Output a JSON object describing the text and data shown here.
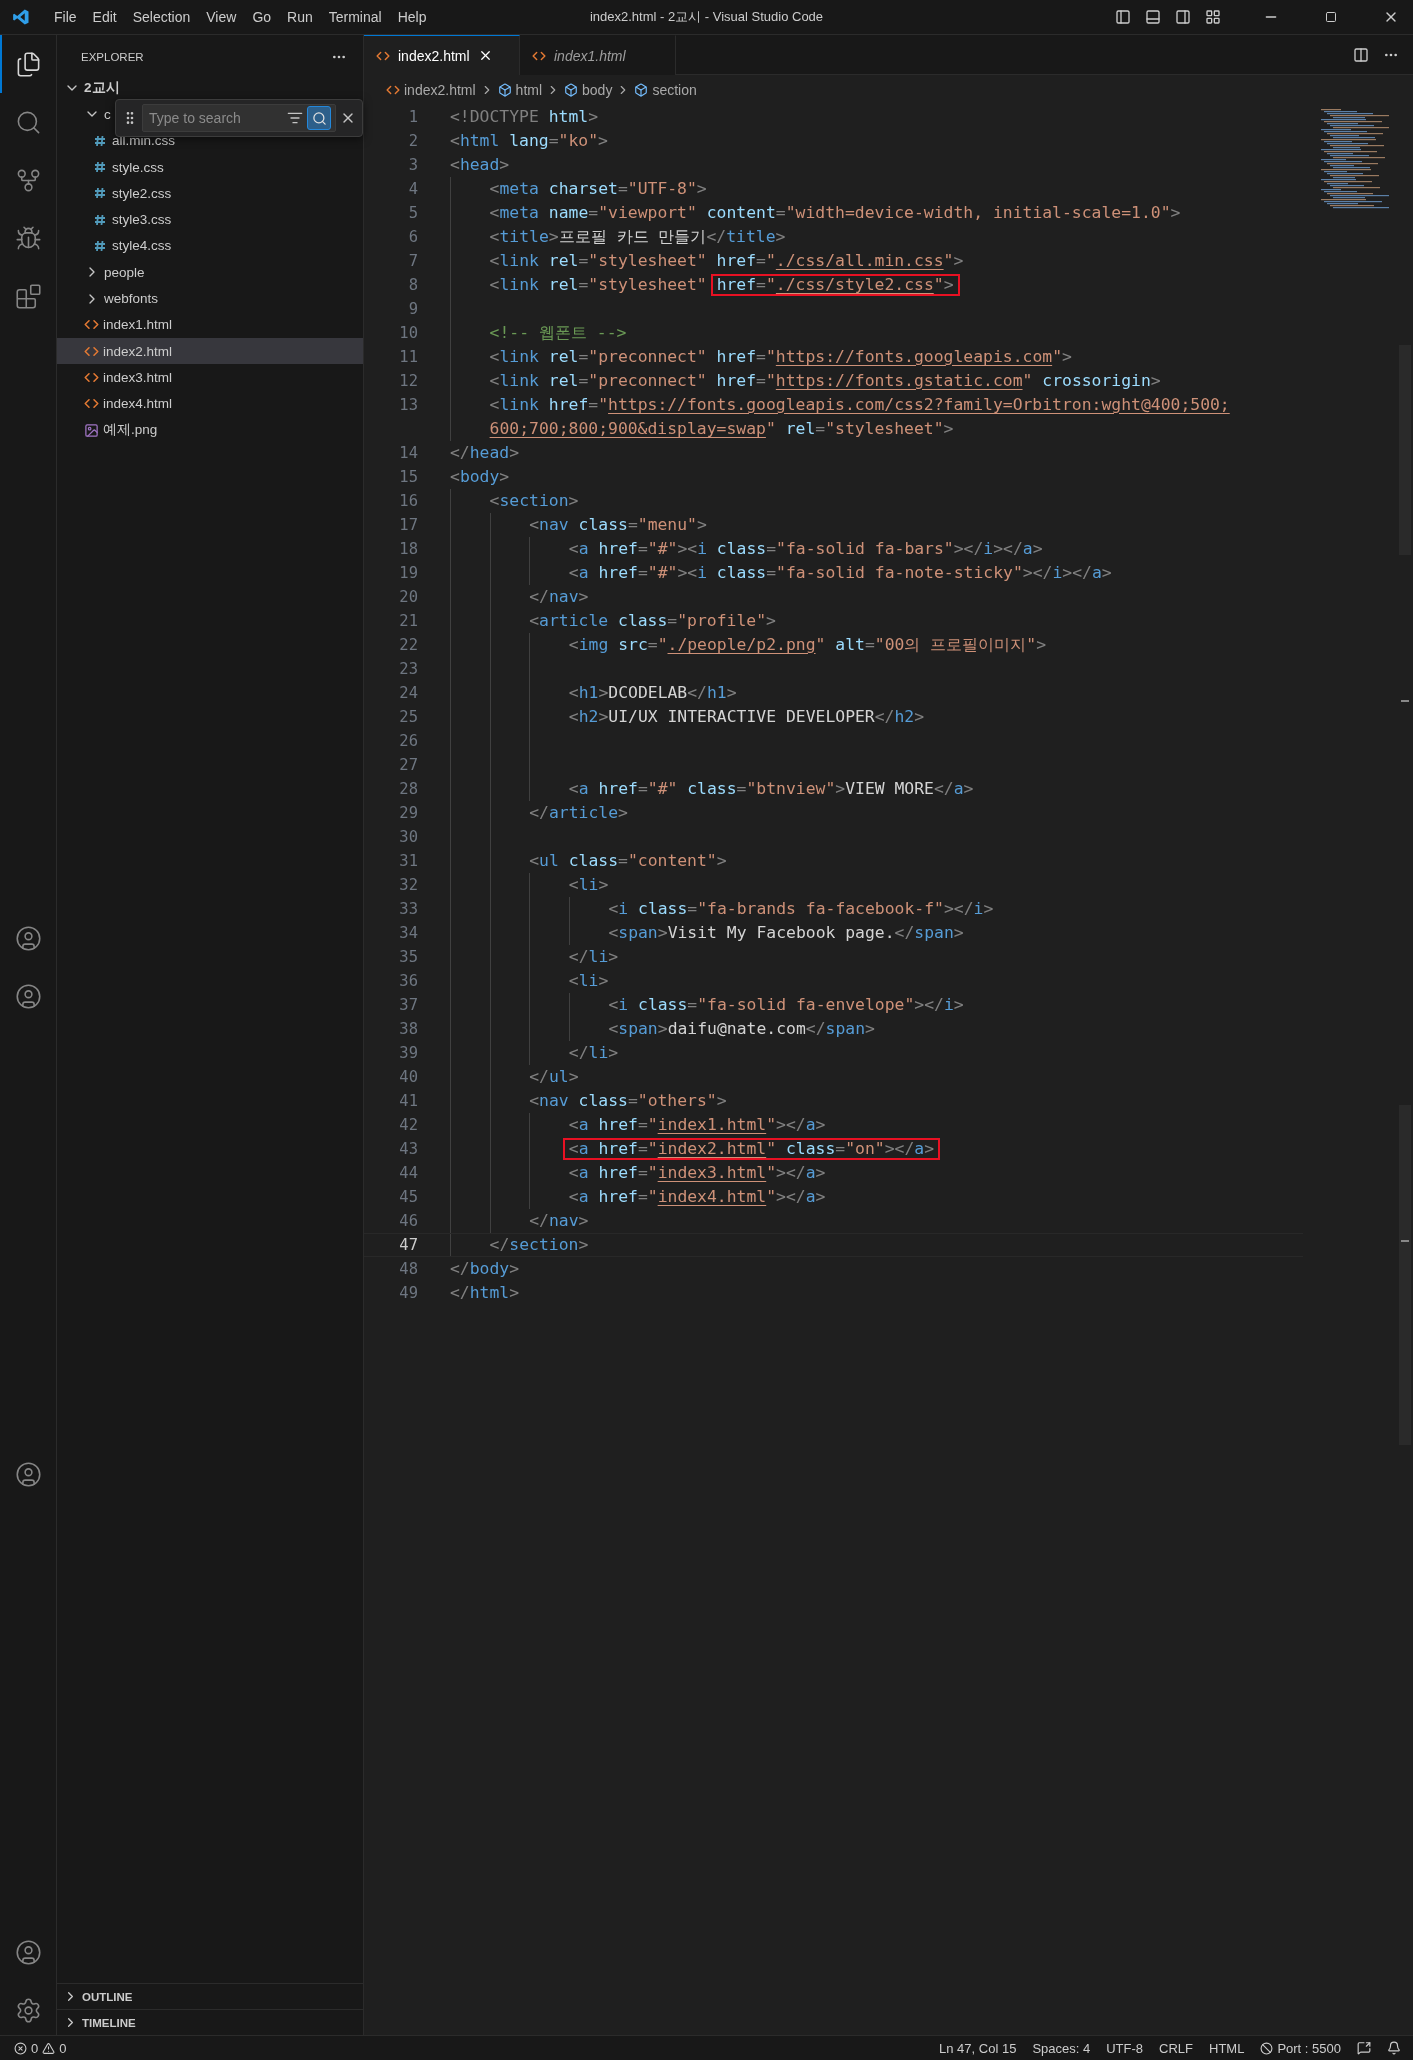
{
  "title_bar": {
    "menus": [
      "File",
      "Edit",
      "Selection",
      "View",
      "Go",
      "Run",
      "Terminal",
      "Help"
    ],
    "title": "index2.html - 2교시 - Visual Studio Code"
  },
  "activity_bar": {
    "groups": [
      [
        {
          "kind": "explorer",
          "selected": true
        },
        {
          "kind": "search",
          "selected": false
        },
        {
          "kind": "source-control",
          "selected": false
        },
        {
          "kind": "run-debug",
          "selected": false
        },
        {
          "kind": "extensions",
          "selected": false
        }
      ],
      [
        {
          "kind": "account",
          "selected": false
        },
        {
          "kind": "account",
          "selected": false
        }
      ],
      [
        {
          "kind": "account",
          "selected": false
        }
      ],
      [
        {
          "kind": "account",
          "selected": false
        },
        {
          "kind": "settings",
          "selected": false
        }
      ]
    ]
  },
  "sidebar": {
    "title": "EXPLORER",
    "tree": [
      {
        "label": "2교시",
        "kind": "folder",
        "expanded": true,
        "selected": false,
        "children": [
          {
            "label": "c",
            "kind": "folder",
            "expanded": true,
            "selected": false,
            "children": [
              {
                "label": "all.min.css",
                "kind": "css",
                "selected": false
              },
              {
                "label": "style.css",
                "kind": "css",
                "selected": false
              },
              {
                "label": "style2.css",
                "kind": "css",
                "selected": false
              },
              {
                "label": "style3.css",
                "kind": "css",
                "selected": false
              },
              {
                "label": "style4.css",
                "kind": "css",
                "selected": false
              }
            ]
          },
          {
            "label": "people",
            "kind": "folder",
            "expanded": false,
            "selected": false
          },
          {
            "label": "webfonts",
            "kind": "folder",
            "expanded": false,
            "selected": false
          },
          {
            "label": "index1.html",
            "kind": "html",
            "selected": false
          },
          {
            "label": "index2.html",
            "kind": "html",
            "selected": true
          },
          {
            "label": "index3.html",
            "kind": "html",
            "selected": false
          },
          {
            "label": "index4.html",
            "kind": "html",
            "selected": false
          },
          {
            "label": "예제.png",
            "kind": "image",
            "selected": false
          }
        ]
      }
    ],
    "find_widget": {
      "placeholder": "Type to search",
      "fuzzy_match": true
    },
    "panels": [
      {
        "label": "OUTLINE",
        "expanded": false
      },
      {
        "label": "TIMELINE",
        "expanded": false
      }
    ]
  },
  "tabs": [
    {
      "label": "index2.html",
      "selected": true,
      "preview": false
    },
    {
      "label": "index1.html",
      "selected": false,
      "preview": true
    }
  ],
  "breadcrumb": [
    {
      "label": "index2.html",
      "kind": "file"
    },
    {
      "label": "html",
      "kind": "element"
    },
    {
      "label": "body",
      "kind": "element"
    },
    {
      "label": "section",
      "kind": "element"
    }
  ],
  "code": [
    {
      "number": "1",
      "current": false,
      "tokens": [
        {
          "kind": "p",
          "text": "<!DOCTYPE"
        },
        {
          "kind": "attr",
          "text": " html"
        },
        {
          "kind": "p",
          "text": ">"
        }
      ]
    },
    {
      "number": "2",
      "current": false,
      "tokens": [
        {
          "kind": "p",
          "text": "<"
        },
        {
          "kind": "tag",
          "text": "html"
        },
        {
          "kind": "attr",
          "text": " lang"
        },
        {
          "kind": "p",
          "text": "="
        },
        {
          "kind": "str",
          "text": "\"ko\""
        },
        {
          "kind": "p",
          "text": ">"
        }
      ]
    },
    {
      "number": "3",
      "current": false,
      "tokens": [
        {
          "kind": "p",
          "text": "<"
        },
        {
          "kind": "tag",
          "text": "head"
        },
        {
          "kind": "p",
          "text": ">"
        }
      ]
    },
    {
      "number": "4",
      "current": false,
      "tokens": [
        {
          "kind": "p",
          "text": "    <"
        },
        {
          "kind": "tag",
          "text": "meta"
        },
        {
          "kind": "attr",
          "text": " charset"
        },
        {
          "kind": "p",
          "text": "="
        },
        {
          "kind": "str",
          "text": "\"UTF-8\""
        },
        {
          "kind": "p",
          "text": ">"
        }
      ]
    },
    {
      "number": "5",
      "current": false,
      "tokens": [
        {
          "kind": "p",
          "text": "    <"
        },
        {
          "kind": "tag",
          "text": "meta"
        },
        {
          "kind": "attr",
          "text": " name"
        },
        {
          "kind": "p",
          "text": "="
        },
        {
          "kind": "str",
          "text": "\"viewport\""
        },
        {
          "kind": "attr",
          "text": " content"
        },
        {
          "kind": "p",
          "text": "="
        },
        {
          "kind": "str",
          "text": "\"width=device-width, initial-scale=1.0\""
        },
        {
          "kind": "p",
          "text": ">"
        }
      ]
    },
    {
      "number": "6",
      "current": false,
      "tokens": [
        {
          "kind": "p",
          "text": "    <"
        },
        {
          "kind": "tag",
          "text": "title"
        },
        {
          "kind": "p",
          "text": ">"
        },
        {
          "kind": "text",
          "text": "프로필 카드 만들기"
        },
        {
          "kind": "p",
          "text": "</"
        },
        {
          "kind": "tag",
          "text": "title"
        },
        {
          "kind": "p",
          "text": ">"
        }
      ]
    },
    {
      "number": "7",
      "current": false,
      "tokens": [
        {
          "kind": "p",
          "text": "    <"
        },
        {
          "kind": "tag",
          "text": "link"
        },
        {
          "kind": "attr",
          "text": " rel"
        },
        {
          "kind": "p",
          "text": "="
        },
        {
          "kind": "str",
          "text": "\"stylesheet\""
        },
        {
          "kind": "attr",
          "text": " href"
        },
        {
          "kind": "p",
          "text": "="
        },
        {
          "kind": "str",
          "text": "\""
        },
        {
          "kind": "link",
          "text": "./css/all.min.css"
        },
        {
          "kind": "str",
          "text": "\""
        },
        {
          "kind": "p",
          "text": ">"
        }
      ]
    },
    {
      "number": "8",
      "current": false,
      "tokens": [
        {
          "kind": "p",
          "text": "    <"
        },
        {
          "kind": "tag",
          "text": "link"
        },
        {
          "kind": "attr",
          "text": " rel"
        },
        {
          "kind": "p",
          "text": "="
        },
        {
          "kind": "str",
          "text": "\"stylesheet\""
        },
        {
          "kind": "box",
          "tokens": [
            {
              "kind": "attr",
              "text": "href"
            },
            {
              "kind": "p",
              "text": "="
            },
            {
              "kind": "str",
              "text": "\""
            },
            {
              "kind": "link",
              "text": "./css/style2.css"
            },
            {
              "kind": "str",
              "text": "\""
            },
            {
              "kind": "p",
              "text": ">"
            }
          ]
        }
      ]
    },
    {
      "number": "9",
      "current": false
    },
    {
      "number": "10",
      "current": false,
      "tokens": [
        {
          "kind": "comment",
          "text": "    <!-- 웹폰트 -->"
        }
      ]
    },
    {
      "number": "11",
      "current": false,
      "tokens": [
        {
          "kind": "p",
          "text": "    <"
        },
        {
          "kind": "tag",
          "text": "link"
        },
        {
          "kind": "attr",
          "text": " rel"
        },
        {
          "kind": "p",
          "text": "="
        },
        {
          "kind": "str",
          "text": "\"preconnect\""
        },
        {
          "kind": "attr",
          "text": " href"
        },
        {
          "kind": "p",
          "text": "="
        },
        {
          "kind": "str",
          "text": "\""
        },
        {
          "kind": "link",
          "text": "https://fonts.googleapis.com"
        },
        {
          "kind": "str",
          "text": "\""
        },
        {
          "kind": "p",
          "text": ">"
        }
      ]
    },
    {
      "number": "12",
      "current": false,
      "tokens": [
        {
          "kind": "p",
          "text": "    <"
        },
        {
          "kind": "tag",
          "text": "link"
        },
        {
          "kind": "attr",
          "text": " rel"
        },
        {
          "kind": "p",
          "text": "="
        },
        {
          "kind": "str",
          "text": "\"preconnect\""
        },
        {
          "kind": "attr",
          "text": " href"
        },
        {
          "kind": "p",
          "text": "="
        },
        {
          "kind": "str",
          "text": "\""
        },
        {
          "kind": "link",
          "text": "https://fonts.gstatic.com"
        },
        {
          "kind": "str",
          "text": "\""
        },
        {
          "kind": "attr",
          "text": " crossorigin"
        },
        {
          "kind": "p",
          "text": ">"
        }
      ]
    },
    {
      "number": "13",
      "current": false,
      "tokens": [
        {
          "kind": "p",
          "text": "    <"
        },
        {
          "kind": "tag",
          "text": "link"
        },
        {
          "kind": "attr",
          "text": " href"
        },
        {
          "kind": "p",
          "text": "="
        },
        {
          "kind": "str",
          "text": "\""
        },
        {
          "kind": "link",
          "text": "https://fonts.googleapis.com/css2?family=Orbitron:wght@400;500;"
        },
        {
          "kind": "break"
        },
        {
          "kind": "link",
          "text": "600;700;800;900&display=swap"
        },
        {
          "kind": "str",
          "text": "\""
        },
        {
          "kind": "attr",
          "text": " rel"
        },
        {
          "kind": "p",
          "text": "="
        },
        {
          "kind": "str",
          "text": "\"stylesheet\""
        },
        {
          "kind": "p",
          "text": ">"
        }
      ]
    },
    {
      "number": "14",
      "current": false,
      "tokens": [
        {
          "kind": "p",
          "text": "</"
        },
        {
          "kind": "tag",
          "text": "head"
        },
        {
          "kind": "p",
          "text": ">"
        }
      ]
    },
    {
      "number": "15",
      "current": false,
      "tokens": [
        {
          "kind": "p",
          "text": "<"
        },
        {
          "kind": "tag",
          "text": "body"
        },
        {
          "kind": "p",
          "text": ">"
        }
      ]
    },
    {
      "number": "16",
      "current": false,
      "tokens": [
        {
          "kind": "p",
          "text": "    <"
        },
        {
          "kind": "tag",
          "text": "section"
        },
        {
          "kind": "p",
          "text": ">"
        }
      ]
    },
    {
      "number": "17",
      "current": false,
      "tokens": [
        {
          "kind": "p",
          "text": "        <"
        },
        {
          "kind": "tag",
          "text": "nav"
        },
        {
          "kind": "attr",
          "text": " class"
        },
        {
          "kind": "p",
          "text": "="
        },
        {
          "kind": "str",
          "text": "\"menu\""
        },
        {
          "kind": "p",
          "text": ">"
        }
      ]
    },
    {
      "number": "18",
      "current": false,
      "tokens": [
        {
          "kind": "p",
          "text": "            <"
        },
        {
          "kind": "tag",
          "text": "a"
        },
        {
          "kind": "attr",
          "text": " href"
        },
        {
          "kind": "p",
          "text": "="
        },
        {
          "kind": "str",
          "text": "\"#\""
        },
        {
          "kind": "p",
          "text": "><"
        },
        {
          "kind": "tag",
          "text": "i"
        },
        {
          "kind": "attr",
          "text": " class"
        },
        {
          "kind": "p",
          "text": "="
        },
        {
          "kind": "str",
          "text": "\"fa-solid fa-bars\""
        },
        {
          "kind": "p",
          "text": "></"
        },
        {
          "kind": "tag",
          "text": "i"
        },
        {
          "kind": "p",
          "text": "></"
        },
        {
          "kind": "tag",
          "text": "a"
        },
        {
          "kind": "p",
          "text": ">"
        }
      ]
    },
    {
      "number": "19",
      "current": false,
      "tokens": [
        {
          "kind": "p",
          "text": "            <"
        },
        {
          "kind": "tag",
          "text": "a"
        },
        {
          "kind": "attr",
          "text": " href"
        },
        {
          "kind": "p",
          "text": "="
        },
        {
          "kind": "str",
          "text": "\"#\""
        },
        {
          "kind": "p",
          "text": "><"
        },
        {
          "kind": "tag",
          "text": "i"
        },
        {
          "kind": "attr",
          "text": " class"
        },
        {
          "kind": "p",
          "text": "="
        },
        {
          "kind": "str",
          "text": "\"fa-solid fa-note-sticky\""
        },
        {
          "kind": "p",
          "text": "></"
        },
        {
          "kind": "tag",
          "text": "i"
        },
        {
          "kind": "p",
          "text": "></"
        },
        {
          "kind": "tag",
          "text": "a"
        },
        {
          "kind": "p",
          "text": ">"
        }
      ]
    },
    {
      "number": "20",
      "current": false,
      "tokens": [
        {
          "kind": "p",
          "text": "        </"
        },
        {
          "kind": "tag",
          "text": "nav"
        },
        {
          "kind": "p",
          "text": ">"
        }
      ]
    },
    {
      "number": "21",
      "current": false,
      "tokens": [
        {
          "kind": "p",
          "text": "        <"
        },
        {
          "kind": "tag",
          "text": "article"
        },
        {
          "kind": "attr",
          "text": " class"
        },
        {
          "kind": "p",
          "text": "="
        },
        {
          "kind": "str",
          "text": "\"profile\""
        },
        {
          "kind": "p",
          "text": ">"
        }
      ]
    },
    {
      "number": "22",
      "current": false,
      "tokens": [
        {
          "kind": "p",
          "text": "            <"
        },
        {
          "kind": "tag",
          "text": "img"
        },
        {
          "kind": "attr",
          "text": " src"
        },
        {
          "kind": "p",
          "text": "="
        },
        {
          "kind": "str",
          "text": "\""
        },
        {
          "kind": "link",
          "text": "./people/p2.png"
        },
        {
          "kind": "str",
          "text": "\""
        },
        {
          "kind": "attr",
          "text": " alt"
        },
        {
          "kind": "p",
          "text": "="
        },
        {
          "kind": "str",
          "text": "\"00의 프로필이미지\""
        },
        {
          "kind": "p",
          "text": ">"
        }
      ]
    },
    {
      "number": "23",
      "current": false
    },
    {
      "number": "24",
      "current": false,
      "tokens": [
        {
          "kind": "p",
          "text": "            <"
        },
        {
          "kind": "tag",
          "text": "h1"
        },
        {
          "kind": "p",
          "text": ">"
        },
        {
          "kind": "text",
          "text": "DCODELAB"
        },
        {
          "kind": "p",
          "text": "</"
        },
        {
          "kind": "tag",
          "text": "h1"
        },
        {
          "kind": "p",
          "text": ">"
        }
      ]
    },
    {
      "number": "25",
      "current": false,
      "tokens": [
        {
          "kind": "p",
          "text": "            <"
        },
        {
          "kind": "tag",
          "text": "h2"
        },
        {
          "kind": "p",
          "text": ">"
        },
        {
          "kind": "text",
          "text": "UI/UX INTERACTIVE DEVELOPER"
        },
        {
          "kind": "p",
          "text": "</"
        },
        {
          "kind": "tag",
          "text": "h2"
        },
        {
          "kind": "p",
          "text": ">"
        }
      ]
    },
    {
      "number": "26",
      "current": false
    },
    {
      "number": "27",
      "current": false
    },
    {
      "number": "28",
      "current": false,
      "tokens": [
        {
          "kind": "p",
          "text": "            <"
        },
        {
          "kind": "tag",
          "text": "a"
        },
        {
          "kind": "attr",
          "text": " href"
        },
        {
          "kind": "p",
          "text": "="
        },
        {
          "kind": "str",
          "text": "\"#\""
        },
        {
          "kind": "attr",
          "text": " class"
        },
        {
          "kind": "p",
          "text": "="
        },
        {
          "kind": "str",
          "text": "\"btnview\""
        },
        {
          "kind": "p",
          "text": ">"
        },
        {
          "kind": "text",
          "text": "VIEW MORE"
        },
        {
          "kind": "p",
          "text": "</"
        },
        {
          "kind": "tag",
          "text": "a"
        },
        {
          "kind": "p",
          "text": ">"
        }
      ]
    },
    {
      "number": "29",
      "current": false,
      "tokens": [
        {
          "kind": "p",
          "text": "        </"
        },
        {
          "kind": "tag",
          "text": "article"
        },
        {
          "kind": "p",
          "text": ">"
        }
      ]
    },
    {
      "number": "30",
      "current": false
    },
    {
      "number": "31",
      "current": false,
      "tokens": [
        {
          "kind": "p",
          "text": "        <"
        },
        {
          "kind": "tag",
          "text": "ul"
        },
        {
          "kind": "attr",
          "text": " class"
        },
        {
          "kind": "p",
          "text": "="
        },
        {
          "kind": "str",
          "text": "\"content\""
        },
        {
          "kind": "p",
          "text": ">"
        }
      ]
    },
    {
      "number": "32",
      "current": false,
      "tokens": [
        {
          "kind": "p",
          "text": "            <"
        },
        {
          "kind": "tag",
          "text": "li"
        },
        {
          "kind": "p",
          "text": ">"
        }
      ]
    },
    {
      "number": "33",
      "current": false,
      "tokens": [
        {
          "kind": "p",
          "text": "                <"
        },
        {
          "kind": "tag",
          "text": "i"
        },
        {
          "kind": "attr",
          "text": " class"
        },
        {
          "kind": "p",
          "text": "="
        },
        {
          "kind": "str",
          "text": "\"fa-brands fa-facebook-f\""
        },
        {
          "kind": "p",
          "text": "></"
        },
        {
          "kind": "tag",
          "text": "i"
        },
        {
          "kind": "p",
          "text": ">"
        }
      ]
    },
    {
      "number": "34",
      "current": false,
      "tokens": [
        {
          "kind": "p",
          "text": "                <"
        },
        {
          "kind": "tag",
          "text": "span"
        },
        {
          "kind": "p",
          "text": ">"
        },
        {
          "kind": "text",
          "text": "Visit My Facebook page."
        },
        {
          "kind": "p",
          "text": "</"
        },
        {
          "kind": "tag",
          "text": "span"
        },
        {
          "kind": "p",
          "text": ">"
        }
      ]
    },
    {
      "number": "35",
      "current": false,
      "tokens": [
        {
          "kind": "p",
          "text": "            </"
        },
        {
          "kind": "tag",
          "text": "li"
        },
        {
          "kind": "p",
          "text": ">"
        }
      ]
    },
    {
      "number": "36",
      "current": false,
      "tokens": [
        {
          "kind": "p",
          "text": "            <"
        },
        {
          "kind": "tag",
          "text": "li"
        },
        {
          "kind": "p",
          "text": ">"
        }
      ]
    },
    {
      "number": "37",
      "current": false,
      "tokens": [
        {
          "kind": "p",
          "text": "                <"
        },
        {
          "kind": "tag",
          "text": "i"
        },
        {
          "kind": "attr",
          "text": " class"
        },
        {
          "kind": "p",
          "text": "="
        },
        {
          "kind": "str",
          "text": "\"fa-solid fa-envelope\""
        },
        {
          "kind": "p",
          "text": "></"
        },
        {
          "kind": "tag",
          "text": "i"
        },
        {
          "kind": "p",
          "text": ">"
        }
      ]
    },
    {
      "number": "38",
      "current": false,
      "tokens": [
        {
          "kind": "p",
          "text": "                <"
        },
        {
          "kind": "tag",
          "text": "span"
        },
        {
          "kind": "p",
          "text": ">"
        },
        {
          "kind": "text",
          "text": "daifu@nate.com"
        },
        {
          "kind": "p",
          "text": "</"
        },
        {
          "kind": "tag",
          "text": "span"
        },
        {
          "kind": "p",
          "text": ">"
        }
      ]
    },
    {
      "number": "39",
      "current": false,
      "tokens": [
        {
          "kind": "p",
          "text": "            </"
        },
        {
          "kind": "tag",
          "text": "li"
        },
        {
          "kind": "p",
          "text": ">"
        }
      ]
    },
    {
      "number": "40",
      "current": false,
      "tokens": [
        {
          "kind": "p",
          "text": "        </"
        },
        {
          "kind": "tag",
          "text": "ul"
        },
        {
          "kind": "p",
          "text": ">"
        }
      ]
    },
    {
      "number": "41",
      "current": false,
      "tokens": [
        {
          "kind": "p",
          "text": "        <"
        },
        {
          "kind": "tag",
          "text": "nav"
        },
        {
          "kind": "attr",
          "text": " class"
        },
        {
          "kind": "p",
          "text": "="
        },
        {
          "kind": "str",
          "text": "\"others\""
        },
        {
          "kind": "p",
          "text": ">"
        }
      ]
    },
    {
      "number": "42",
      "current": false,
      "tokens": [
        {
          "kind": "p",
          "text": "            <"
        },
        {
          "kind": "tag",
          "text": "a"
        },
        {
          "kind": "attr",
          "text": " href"
        },
        {
          "kind": "p",
          "text": "="
        },
        {
          "kind": "str",
          "text": "\""
        },
        {
          "kind": "link",
          "text": "index1.html"
        },
        {
          "kind": "str",
          "text": "\""
        },
        {
          "kind": "p",
          "text": "></"
        },
        {
          "kind": "tag",
          "text": "a"
        },
        {
          "kind": "p",
          "text": ">"
        }
      ]
    },
    {
      "number": "43",
      "current": false,
      "tokens": [
        {
          "kind": "box",
          "tokens": [
            {
              "kind": "p",
              "text": "            <"
            },
            {
              "kind": "tag",
              "text": "a"
            },
            {
              "kind": "attr",
              "text": " href"
            },
            {
              "kind": "p",
              "text": "="
            },
            {
              "kind": "str",
              "text": "\""
            },
            {
              "kind": "link",
              "text": "index2.html"
            },
            {
              "kind": "str",
              "text": "\""
            },
            {
              "kind": "attr",
              "text": " class"
            },
            {
              "kind": "p",
              "text": "="
            },
            {
              "kind": "str",
              "text": "\"on\""
            },
            {
              "kind": "p",
              "text": "></"
            },
            {
              "kind": "tag",
              "text": "a"
            },
            {
              "kind": "p",
              "text": ">"
            }
          ]
        }
      ]
    },
    {
      "number": "44",
      "current": false,
      "tokens": [
        {
          "kind": "p",
          "text": "            <"
        },
        {
          "kind": "tag",
          "text": "a"
        },
        {
          "kind": "attr",
          "text": " href"
        },
        {
          "kind": "p",
          "text": "="
        },
        {
          "kind": "str",
          "text": "\""
        },
        {
          "kind": "link",
          "text": "index3.html"
        },
        {
          "kind": "str",
          "text": "\""
        },
        {
          "kind": "p",
          "text": "></"
        },
        {
          "kind": "tag",
          "text": "a"
        },
        {
          "kind": "p",
          "text": ">"
        }
      ]
    },
    {
      "number": "45",
      "current": false,
      "tokens": [
        {
          "kind": "p",
          "text": "            <"
        },
        {
          "kind": "tag",
          "text": "a"
        },
        {
          "kind": "attr",
          "text": " href"
        },
        {
          "kind": "p",
          "text": "="
        },
        {
          "kind": "str",
          "text": "\""
        },
        {
          "kind": "link",
          "text": "index4.html"
        },
        {
          "kind": "str",
          "text": "\""
        },
        {
          "kind": "p",
          "text": "></"
        },
        {
          "kind": "tag",
          "text": "a"
        },
        {
          "kind": "p",
          "text": ">"
        }
      ]
    },
    {
      "number": "46",
      "current": false,
      "tokens": [
        {
          "kind": "p",
          "text": "        </"
        },
        {
          "kind": "tag",
          "text": "nav"
        },
        {
          "kind": "p",
          "text": ">"
        }
      ]
    },
    {
      "number": "47",
      "current": true,
      "tokens": [
        {
          "kind": "p",
          "text": "    </"
        },
        {
          "kind": "tag",
          "text": "section"
        },
        {
          "kind": "p",
          "text": ">"
        }
      ]
    },
    {
      "number": "48",
      "current": false,
      "tokens": [
        {
          "kind": "p",
          "text": "</"
        },
        {
          "kind": "tag",
          "text": "body"
        },
        {
          "kind": "p",
          "text": ">"
        }
      ]
    },
    {
      "number": "49",
      "current": false,
      "tokens": [
        {
          "kind": "p",
          "text": "</"
        },
        {
          "kind": "tag",
          "text": "html"
        },
        {
          "kind": "p",
          "text": ">"
        }
      ]
    }
  ],
  "status_bar": {
    "errors": "0",
    "warnings": "0",
    "items": [
      {
        "kind": "text",
        "label": "Ln 47, Col 15"
      },
      {
        "kind": "text",
        "label": "Spaces: 4"
      },
      {
        "kind": "text",
        "label": "UTF-8"
      },
      {
        "kind": "text",
        "label": "CRLF"
      },
      {
        "kind": "text",
        "label": "HTML"
      },
      {
        "kind": "port",
        "label": "Port : 5500"
      }
    ]
  }
}
